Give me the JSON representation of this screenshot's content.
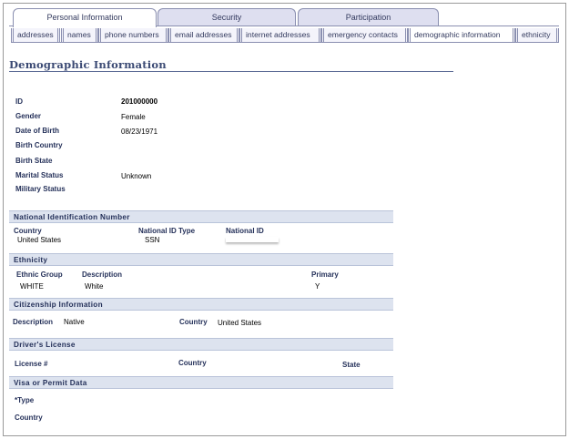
{
  "tabs": [
    {
      "label": "Personal Information",
      "active": true
    },
    {
      "label": "Security",
      "active": false
    },
    {
      "label": "Participation",
      "active": false
    }
  ],
  "subtabs": [
    {
      "label": "addresses"
    },
    {
      "label": "names"
    },
    {
      "label": "phone numbers"
    },
    {
      "label": "email addresses"
    },
    {
      "label": "internet addresses"
    },
    {
      "label": "emergency contacts"
    },
    {
      "label": "demographic information",
      "active": true
    },
    {
      "label": "ethnicity"
    }
  ],
  "page_title": "Demographic Information",
  "demographics": {
    "id_label": "ID",
    "id_value": "201000000",
    "gender_label": "Gender",
    "gender_value": "Female",
    "dob_label": "Date of Birth",
    "dob_value": "08/23/1971",
    "birth_country_label": "Birth Country",
    "birth_state_label": "Birth State",
    "marital_label": "Marital Status",
    "marital_value": "Unknown",
    "military_label": "Military Status"
  },
  "national_id": {
    "header": "National Identification Number",
    "country_label": "Country",
    "country_value": "United States",
    "type_label": "National ID Type",
    "type_value": "SSN",
    "id_label": "National ID"
  },
  "ethnicity": {
    "header": "Ethnicity",
    "group_label": "Ethnic Group",
    "group_value": "WHITE",
    "desc_label": "Description",
    "desc_value": "White",
    "primary_label": "Primary",
    "primary_value": "Y"
  },
  "citizenship": {
    "header": "Citizenship Information",
    "desc_label": "Description",
    "desc_value": "Native",
    "country_label": "Country",
    "country_value": "United States"
  },
  "drivers_license": {
    "header": "Driver's License",
    "license_label": "License #",
    "country_label": "Country",
    "state_label": "State"
  },
  "visa": {
    "header": "Visa or Permit Data",
    "type_label": "*Type",
    "country_label": "Country"
  },
  "colors": {
    "accent": "#3b4a74",
    "section_bg": "#dde3ef",
    "tab_bg": "#dedff0"
  }
}
